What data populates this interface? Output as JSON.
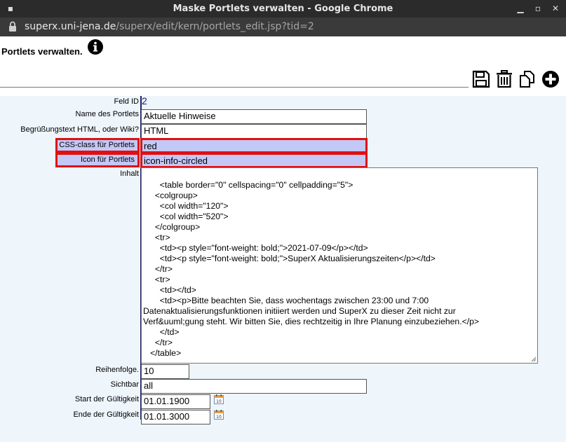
{
  "window": {
    "title": "Maske Portlets verwalten - Google Chrome",
    "url_domain": "superx.uni-jena.de",
    "url_path": "/superx/edit/kern/portlets_edit.jsp?tid=2"
  },
  "page": {
    "title": "Portlets verwalten."
  },
  "toolbar": {
    "icons": [
      "save-icon",
      "trash-icon",
      "copy-icon",
      "add-icon"
    ]
  },
  "form": {
    "feld_id": {
      "label": "Feld ID",
      "value": "2"
    },
    "name": {
      "label": "Name des Portlets",
      "value": "Aktuelle Hinweise"
    },
    "greeting": {
      "label": "Begrüßungstext HTML, oder Wiki?",
      "value": "HTML"
    },
    "css_class": {
      "label": "CSS-class für Portlets",
      "value": "red"
    },
    "icon": {
      "label": "Icon für Portlets",
      "value": "icon-info-circled"
    },
    "inhalt": {
      "label": "Inhalt",
      "value": "   <table border=\"0\" cellspacing=\"0\" cellpadding=\"5\">\n     <colgroup>\n       <col width=\"120\">\n       <col width=\"520\">\n     </colgroup>\n     <tr>\n       <td><p style=\"font-weight: bold;\">2021-07-09</p></td>\n       <td><p style=\"font-weight: bold;\">SuperX Aktualisierungszeiten</p></td>\n     </tr>\n     <tr>\n       <td></td>\n       <td><p>Bitte beachten Sie, dass wochentags zwischen 23:00 und 7:00\nDatenaktualisierungsfunktionen initiiert werden und SuperX zu dieser Zeit nicht zur\nVerf&uuml;gung steht. Wir bitten Sie, dies rechtzeitig in Ihre Planung einzubeziehen.</p>\n       </td>\n     </tr>\n   </table>"
    },
    "reihenfolge": {
      "label": "Reihenfolge.",
      "value": "10"
    },
    "sichtbar": {
      "label": "Sichtbar",
      "value": "all"
    },
    "start": {
      "label": "Start der Gültigkeit",
      "value": "01.01.1900"
    },
    "ende": {
      "label": "Ende der Gültigkeit",
      "value": "01.01.3000"
    }
  },
  "colors": {
    "highlight_border": "#e01010",
    "highlight_fill": "#c4c8f7",
    "form_bg": "#eef5fb"
  }
}
